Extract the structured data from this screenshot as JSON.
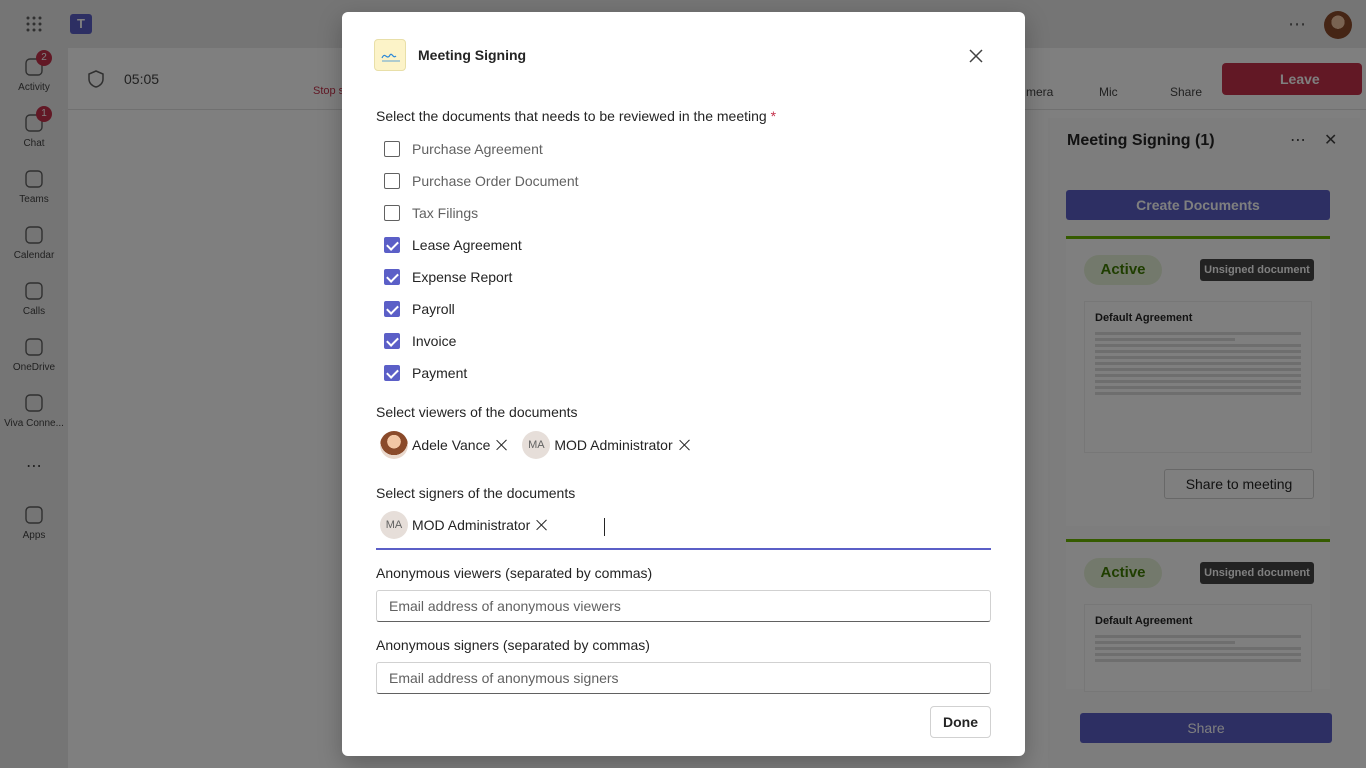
{
  "app": {
    "rail": [
      {
        "label": "Activity",
        "badge": "2",
        "icon": "bell-icon"
      },
      {
        "label": "Chat",
        "badge": "1",
        "icon": "chat-icon"
      },
      {
        "label": "Teams",
        "badge": "",
        "icon": "teams-icon"
      },
      {
        "label": "Calendar",
        "badge": "",
        "icon": "calendar-icon"
      },
      {
        "label": "Calls",
        "badge": "",
        "icon": "phone-icon"
      },
      {
        "label": "OneDrive",
        "badge": "",
        "icon": "cloud-icon"
      },
      {
        "label": "Viva Conne...",
        "badge": "",
        "icon": "viva-icon"
      },
      {
        "label": "Apps",
        "badge": "",
        "icon": "apps-icon"
      }
    ],
    "meeting": {
      "timer": "05:05",
      "stop_label": "Stop s",
      "camera_label": "mera",
      "mic_label": "Mic",
      "share_label": "Share",
      "leave_label": "Leave"
    },
    "panel": {
      "title": "Meeting Signing (1)",
      "create_label": "Create Documents",
      "cards": [
        {
          "status": "Active",
          "tag": "Unsigned document",
          "doc_title": "Default Agreement",
          "share_label": "Share to meeting"
        },
        {
          "status": "Active",
          "tag": "Unsigned document",
          "doc_title": "Default Agreement",
          "share_label": ""
        }
      ],
      "share_label": "Share"
    },
    "colors": {
      "accent": "#5b5fc7",
      "leave": "#c4314b",
      "active_green": "#6bb700"
    }
  },
  "dialog": {
    "title": "Meeting Signing",
    "documents_label": "Select the documents that needs to be reviewed in the meeting",
    "required_mark": "*",
    "documents": [
      {
        "label": "Purchase Agreement",
        "checked": false
      },
      {
        "label": "Purchase Order Document",
        "checked": false
      },
      {
        "label": "Tax Filings",
        "checked": false
      },
      {
        "label": "Lease Agreement",
        "checked": true
      },
      {
        "label": "Expense Report",
        "checked": true
      },
      {
        "label": "Payroll",
        "checked": true
      },
      {
        "label": "Invoice",
        "checked": true
      },
      {
        "label": "Payment",
        "checked": true
      }
    ],
    "viewers_label": "Select viewers of the documents",
    "viewers": [
      {
        "name": "Adele Vance",
        "initials": "",
        "photo": true
      },
      {
        "name": "MOD Administrator",
        "initials": "MA",
        "photo": false
      }
    ],
    "signers_label": "Select signers of the documents",
    "signers": [
      {
        "name": "MOD Administrator",
        "initials": "MA",
        "photo": false
      }
    ],
    "anon_viewers_label": "Anonymous viewers (separated by commas)",
    "anon_viewers_placeholder": "Email address of anonymous viewers",
    "anon_signers_label": "Anonymous signers (separated by commas)",
    "anon_signers_placeholder": "Email address of anonymous signers",
    "done_label": "Done"
  }
}
